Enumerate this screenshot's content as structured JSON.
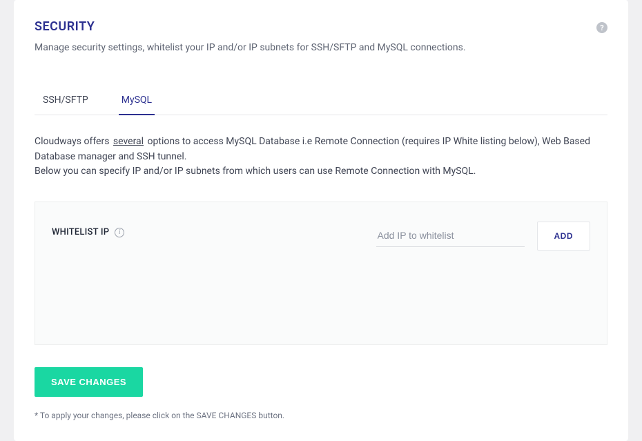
{
  "header": {
    "title": "SECURITY",
    "subtitle": "Manage security settings, whitelist your IP and/or IP subnets for SSH/SFTP and MySQL connections."
  },
  "tabs": {
    "ssh": "SSH/SFTP",
    "mysql": "MySQL"
  },
  "description": {
    "part1": "Cloudways offers ",
    "link": "several",
    "part2": " options to access MySQL Database i.e Remote Connection (requires IP White listing below), Web Based Database manager and SSH tunnel.",
    "line2": "Below you can specify IP and/or IP subnets from which users can use Remote Connection with MySQL."
  },
  "whitelist": {
    "label": "WHITELIST IP",
    "placeholder": "Add IP to whitelist",
    "add_label": "ADD"
  },
  "actions": {
    "save_label": "SAVE CHANGES"
  },
  "footnote": "* To apply your changes, please click on the SAVE CHANGES button."
}
